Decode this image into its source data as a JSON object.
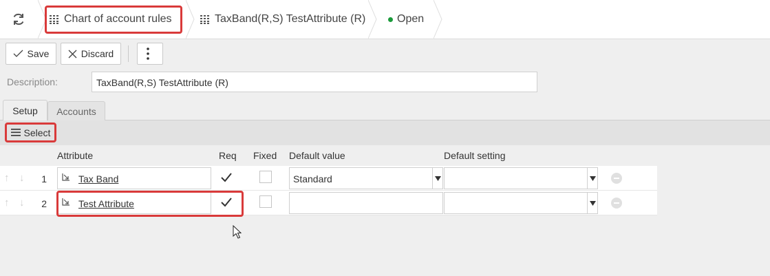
{
  "breadcrumb": {
    "items": [
      {
        "label": "Chart of account rules"
      },
      {
        "label": "TaxBand(R,S) TestAttribute (R)"
      },
      {
        "label": "Open"
      }
    ]
  },
  "toolbar": {
    "save_label": "Save",
    "discard_label": "Discard"
  },
  "form": {
    "description_label": "Description:",
    "description_value": "TaxBand(R,S) TestAttribute (R)"
  },
  "tabs": [
    {
      "label": "Setup",
      "active": true
    },
    {
      "label": "Accounts",
      "active": false
    }
  ],
  "select_label": "Select",
  "grid": {
    "columns": [
      "Attribute",
      "Req",
      "Fixed",
      "Default value",
      "Default setting"
    ],
    "rows": [
      {
        "num": "1",
        "attribute": "Tax Band",
        "req": true,
        "fixed": false,
        "default_value": "Standard",
        "default_setting": ""
      },
      {
        "num": "2",
        "attribute": "Test Attribute",
        "req": true,
        "fixed": false,
        "default_value": "",
        "default_setting": ""
      }
    ]
  },
  "colors": {
    "highlight": "#d93a3a",
    "status_open": "#1a9a3a"
  }
}
